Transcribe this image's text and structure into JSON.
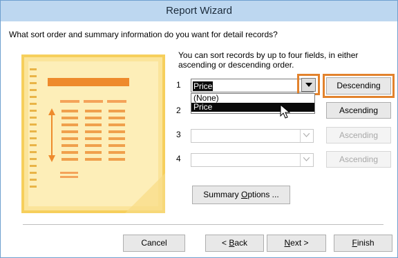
{
  "window": {
    "title": "Report Wizard"
  },
  "question": "What sort order and summary information do you want for detail records?",
  "info": "You can sort records by up to four fields, in either ascending or descending order.",
  "sorts": [
    {
      "num": "1",
      "value": "Price",
      "order": "Descending",
      "enabled": true
    },
    {
      "num": "2",
      "value": "",
      "order": "Ascending",
      "enabled": true
    },
    {
      "num": "3",
      "value": "",
      "order": "Ascending",
      "enabled": false
    },
    {
      "num": "4",
      "value": "",
      "order": "Ascending",
      "enabled": false
    }
  ],
  "dropdown_options": [
    "(None)",
    "Price"
  ],
  "dropdown_selected": "Price",
  "summary_button": {
    "pre": "Summary ",
    "key": "O",
    "post": "ptions ..."
  },
  "footer": {
    "cancel": "Cancel",
    "back": {
      "pre": "< ",
      "key": "B",
      "post": "ack"
    },
    "next": {
      "key": "N",
      "post": "ext >"
    },
    "finish": {
      "key": "F",
      "post": "inish"
    }
  },
  "colors": {
    "titlebar": "#bdd7f0",
    "highlight": "#e2822c",
    "art_bg": "#f6cf5c",
    "art_accent": "#ee8a2c"
  }
}
